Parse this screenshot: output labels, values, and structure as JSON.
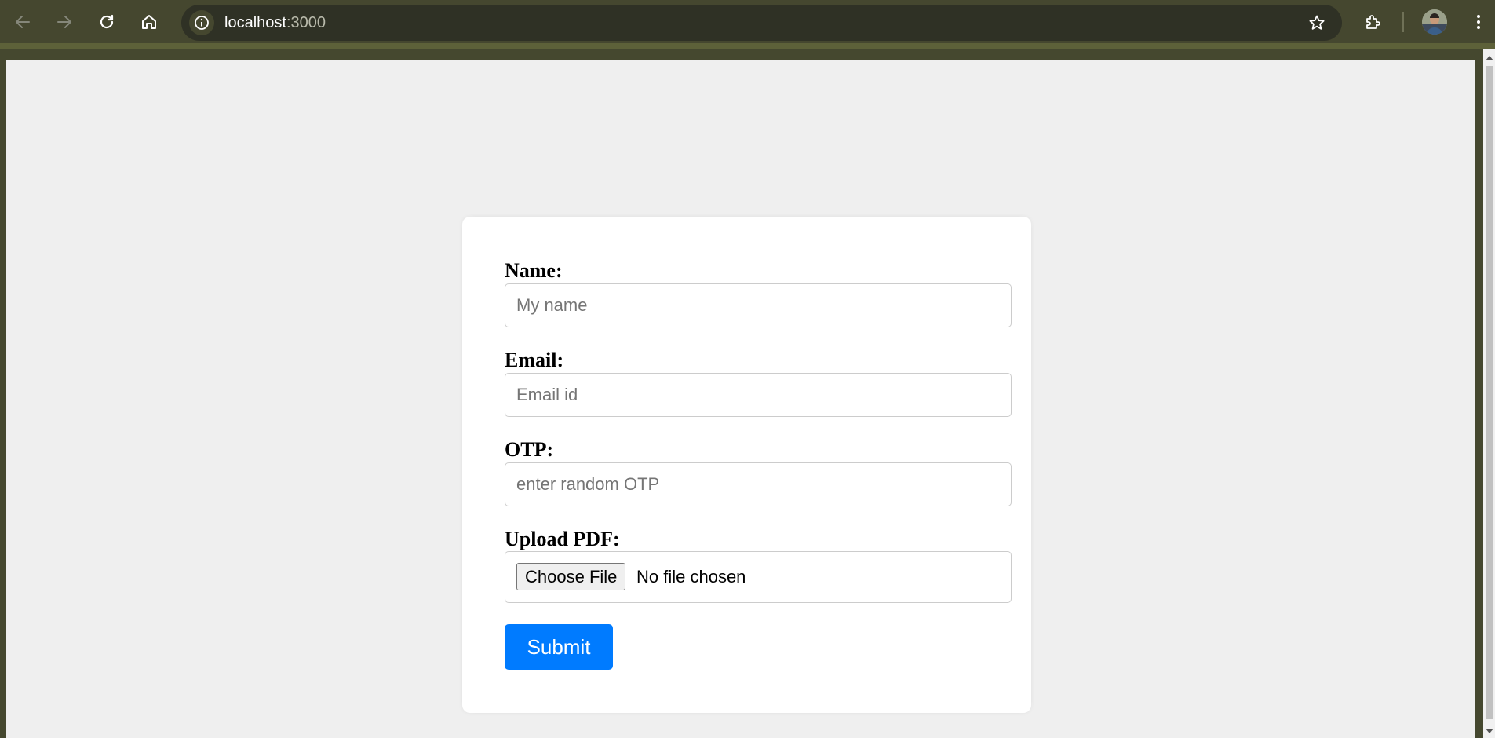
{
  "browser": {
    "url_host": "localhost",
    "url_port": ":3000",
    "icons": {
      "back": "back-arrow-icon",
      "forward": "forward-arrow-icon",
      "reload": "reload-icon",
      "home": "home-icon",
      "site_info": "info-icon",
      "bookmark": "star-icon",
      "extensions": "puzzle-icon",
      "menu": "kebab-menu-icon"
    }
  },
  "form": {
    "name_label": "Name:",
    "name_placeholder": "My name",
    "email_label": "Email:",
    "email_placeholder": "Email id",
    "otp_label": "OTP:",
    "otp_placeholder": "enter random OTP",
    "upload_label": "Upload PDF:",
    "file_button_label": "Choose File",
    "file_status": "No file chosen",
    "submit_label": "Submit"
  },
  "colors": {
    "chrome": "#45472f",
    "page_background": "#efefef",
    "card_background": "#ffffff",
    "submit_button": "#007bff"
  }
}
